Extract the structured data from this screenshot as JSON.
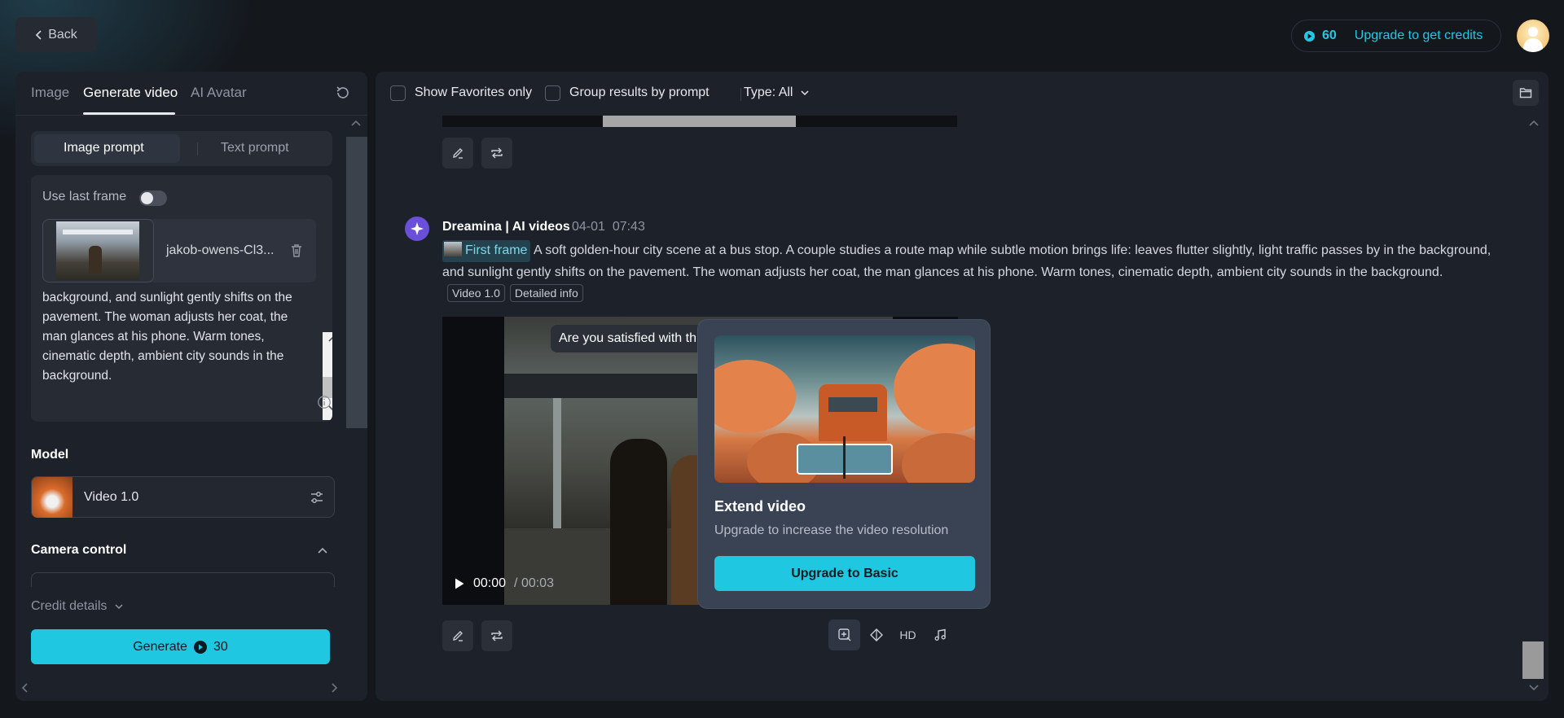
{
  "header": {
    "back_label": "Back",
    "credits_count": "60",
    "upgrade_label": "Upgrade to get credits"
  },
  "left": {
    "tabs": [
      {
        "label": "Image"
      },
      {
        "label": "Generate video"
      },
      {
        "label": "AI Avatar"
      }
    ],
    "prompt_modes": [
      {
        "label": "Image prompt"
      },
      {
        "label": "Text prompt"
      }
    ],
    "use_last_frame_label": "Use last frame",
    "file_name": "jakob-owens-Cl3...",
    "prompt_text": "background, and sunlight gently shifts on the pavement. The woman adjusts her coat, the man glances at his phone. Warm tones, cinematic depth, ambient city sounds in the background.",
    "model_label": "Model",
    "model_name": "Video 1.0",
    "camera_control_label": "Camera control",
    "credit_details_label": "Credit details",
    "generate_label": "Generate",
    "generate_cost": "30"
  },
  "filters": {
    "favorites_label": "Show Favorites only",
    "group_label": "Group results by prompt",
    "type_label": "Type: All"
  },
  "result": {
    "author": "Dreamina | AI videos",
    "date": "04-01",
    "time": "07:43",
    "first_frame_label": "First frame",
    "description": "A soft golden-hour city scene at a bus stop. A couple studies a route map while subtle motion brings life: leaves flutter slightly, light traffic passes by in the background, and sunlight gently shifts on the pavement. The woman adjusts her coat, the man glances at his phone. Warm tones, cinematic depth, ambient city sounds in the background.",
    "tag_model": "Video 1.0",
    "tag_info": "Detailed info",
    "satisfied_prompt": "Are you satisfied with th",
    "current_time": "00:00",
    "duration": "/ 00:03",
    "hd_label": "HD"
  },
  "popover": {
    "title": "Extend video",
    "subtitle": "Upgrade to increase the video resolution",
    "button_label": "Upgrade to Basic"
  },
  "colors": {
    "accent": "#20c7e1",
    "background": "#14171c",
    "panel": "#1d2129"
  }
}
